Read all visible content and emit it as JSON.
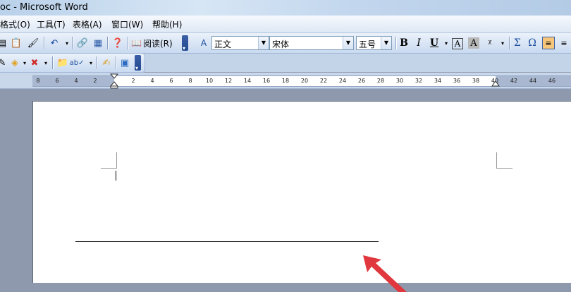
{
  "window": {
    "title": "oc - Microsoft Word"
  },
  "menu": {
    "items": [
      "格式(O)",
      "工具(T)",
      "表格(A)",
      "窗口(W)",
      "帮助(H)"
    ]
  },
  "toolbar": {
    "read_label": "阅读(R)",
    "style_value": "正文",
    "font_value": "宋体",
    "size_value": "五号",
    "bold": "B",
    "italic": "I",
    "underline": "U",
    "sigma": "Σ",
    "omega": "Ω"
  },
  "ruler": {
    "labels": [
      "8",
      "6",
      "4",
      "2",
      "2",
      "4",
      "6",
      "8",
      "10",
      "12",
      "14",
      "16",
      "18",
      "20",
      "22",
      "24",
      "26",
      "28",
      "30",
      "32",
      "34",
      "36",
      "38",
      "40",
      "42",
      "44",
      "46"
    ]
  },
  "colors": {
    "accent_arrow": "#e0383e",
    "title_bar": "#c3d7ee",
    "page": "#ffffff"
  }
}
